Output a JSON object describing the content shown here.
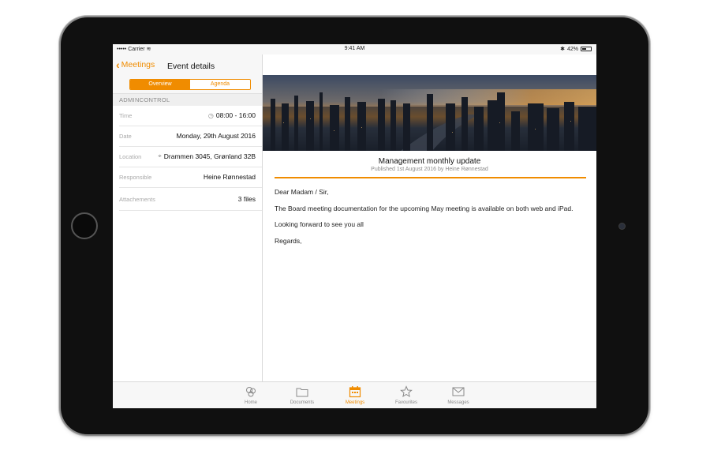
{
  "status": {
    "carrier": "Carrier",
    "time": "9:41 AM",
    "battery": "42%"
  },
  "nav": {
    "back_label": "Meetings",
    "title": "Event details"
  },
  "segments": [
    {
      "label": "Overview",
      "active": true
    },
    {
      "label": "Agenda",
      "active": false
    }
  ],
  "section_header": "ADMINCONTROL",
  "details": [
    {
      "label": "Time",
      "value": "08:00 - 16:00",
      "icon": "clock-icon"
    },
    {
      "label": "Date",
      "value": "Monday, 29th August 2016"
    },
    {
      "label": "Location",
      "value": "Drammen 3045, Grønland 32B",
      "icon": "location-pin-icon"
    },
    {
      "label": "Responsible",
      "value": "Heine Rønnestad"
    },
    {
      "label": "Attachements",
      "value": "3 files"
    }
  ],
  "article": {
    "title": "Management monthly update",
    "meta": "Published 1st August 2016 by Heine Rønnestad",
    "paragraphs": [
      "Dear Madam / Sir,",
      "The Board meeting documentation for the upcoming May meeting is available on both web and iPad.",
      "Looking forward to see you all",
      "Regards,"
    ]
  },
  "tabs": [
    {
      "label": "Home",
      "icon": "home-icon"
    },
    {
      "label": "Documents",
      "icon": "folder-icon"
    },
    {
      "label": "Meetings",
      "icon": "calendar-icon",
      "active": true
    },
    {
      "label": "Favourites",
      "icon": "star-icon"
    },
    {
      "label": "Messages",
      "icon": "envelope-icon"
    }
  ],
  "colors": {
    "accent": "#f08c00",
    "device": "#101010"
  }
}
